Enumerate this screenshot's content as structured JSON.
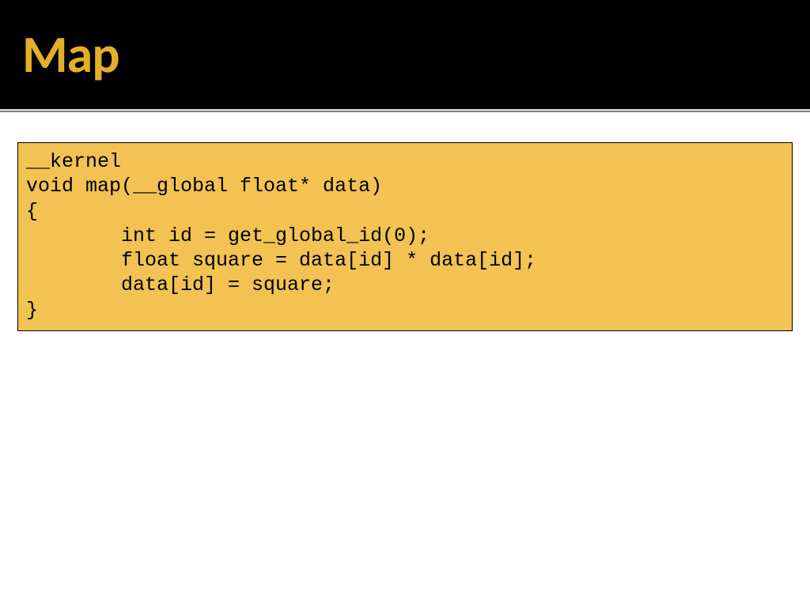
{
  "slide": {
    "title": "Map",
    "code": "__kernel\nvoid map(__global float* data)\n{\n        int id = get_global_id(0);\n        float square = data[id] * data[id];\n        data[id] = square;\n}"
  }
}
